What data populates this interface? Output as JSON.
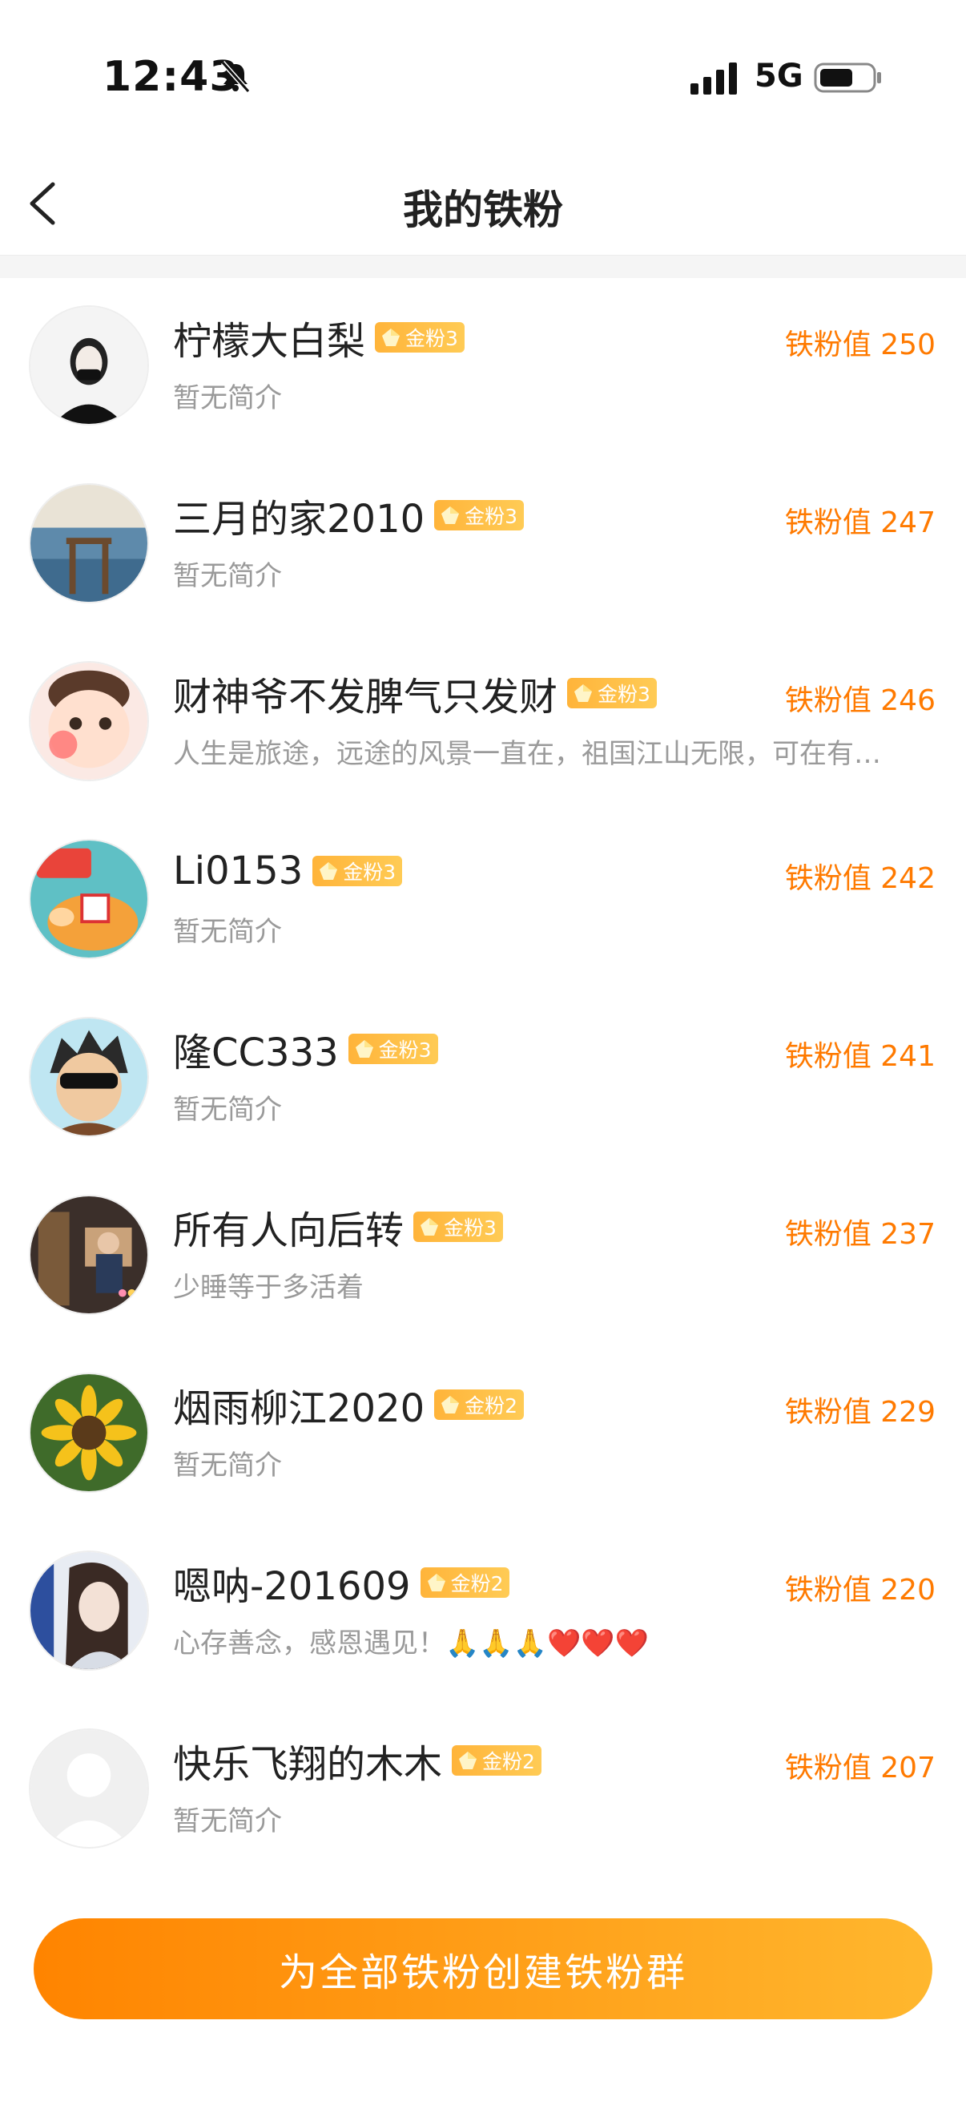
{
  "status_bar": {
    "time": "12:43",
    "network": "5G"
  },
  "header": {
    "title": "我的铁粉"
  },
  "fans": [
    {
      "name": "柠檬大白梨",
      "badge": "金粉3",
      "value_label": "铁粉值 250",
      "bio": "暂无简介"
    },
    {
      "name": "三月的家2010",
      "badge": "金粉3",
      "value_label": "铁粉值 247",
      "bio": "暂无简介"
    },
    {
      "name": "财神爷不发脾气只发财",
      "badge": "金粉3",
      "value_label": "铁粉值 246",
      "bio": "人生是旅途，远途的风景一直在，祖国江山无限，可在有…"
    },
    {
      "name": "Li0153",
      "badge": "金粉3",
      "value_label": "铁粉值 242",
      "bio": "暂无简介"
    },
    {
      "name": "隆CC333",
      "badge": "金粉3",
      "value_label": "铁粉值 241",
      "bio": "暂无简介"
    },
    {
      "name": "所有人向后转",
      "badge": "金粉3",
      "value_label": "铁粉值 237",
      "bio": "少睡等于多活着"
    },
    {
      "name": "烟雨柳江2020",
      "badge": "金粉2",
      "value_label": "铁粉值 229",
      "bio": "暂无简介"
    },
    {
      "name": "嗯呐-201609",
      "badge": "金粉2",
      "value_label": "铁粉值 220",
      "bio": "心存善念，感恩遇见！🙏🙏🙏❤️❤️❤️"
    },
    {
      "name": "快乐飞翔的木木",
      "badge": "金粉2",
      "value_label": "铁粉值 207",
      "bio": "暂无简介"
    }
  ],
  "cta": {
    "label": "为全部铁粉创建铁粉群"
  },
  "colors": {
    "accent": "#ff7a00",
    "badge": "#ffb43a",
    "cta_start": "#ff8400",
    "cta_end": "#ffb72e"
  }
}
